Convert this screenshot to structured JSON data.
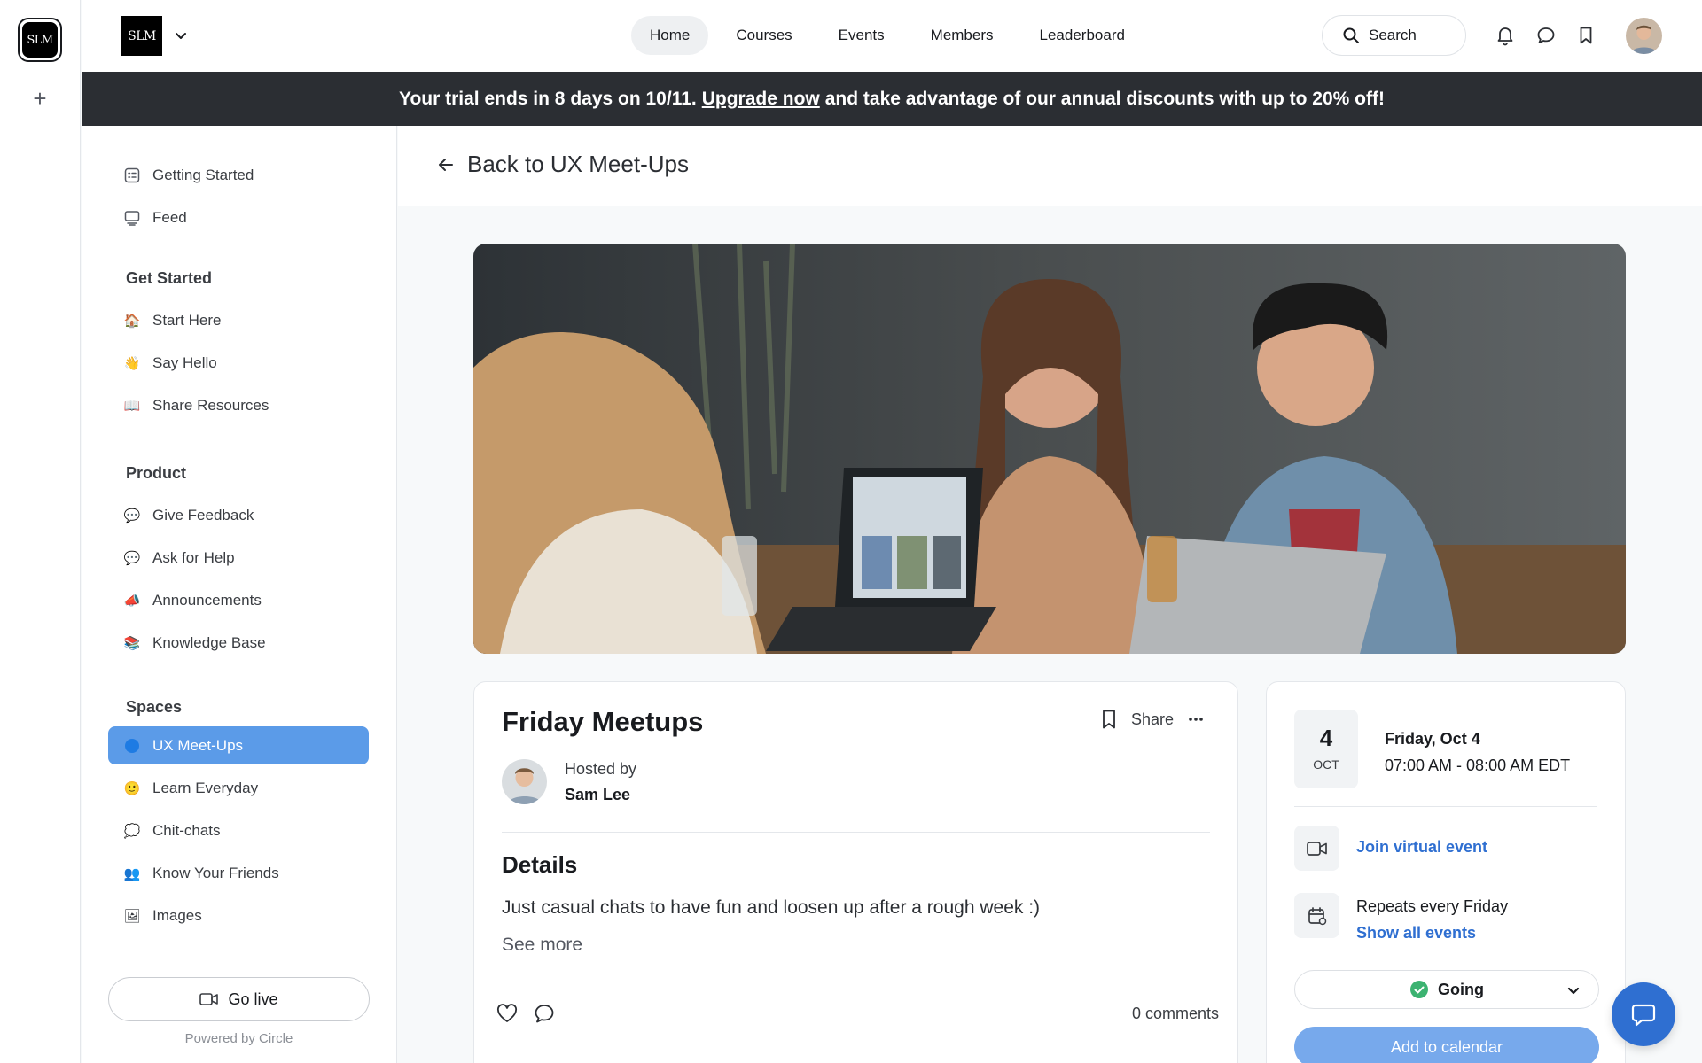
{
  "rail": {
    "logo_text": "SLM"
  },
  "header": {
    "brand_text": "SLM",
    "nav": [
      "Home",
      "Courses",
      "Events",
      "Members",
      "Leaderboard"
    ],
    "search_label": "Search"
  },
  "banner": {
    "prefix": "Your trial ends in 8 days on 10/11.",
    "link": "Upgrade now",
    "suffix": "and take advantage of our annual discounts with up to 20% off!"
  },
  "sidebar": {
    "top_items": [
      {
        "label": "Getting Started",
        "icon": "checklist-icon"
      },
      {
        "label": "Feed",
        "icon": "feed-icon"
      }
    ],
    "sections": [
      {
        "title": "Get Started",
        "items": [
          {
            "label": "Start Here",
            "emoji": "🏠"
          },
          {
            "label": "Say Hello",
            "emoji": "👋"
          },
          {
            "label": "Share Resources",
            "emoji": "📖"
          }
        ]
      },
      {
        "title": "Product",
        "items": [
          {
            "label": "Give Feedback",
            "emoji": "💬"
          },
          {
            "label": "Ask for Help",
            "emoji": "💬"
          },
          {
            "label": "Announcements",
            "emoji": "📣"
          },
          {
            "label": "Knowledge Base",
            "emoji": "📚"
          }
        ]
      },
      {
        "title": "Spaces",
        "items": [
          {
            "label": "UX Meet-Ups",
            "emoji": "🔵",
            "active": true
          },
          {
            "label": "Learn Everyday",
            "emoji": "🙂"
          },
          {
            "label": "Chit-chats",
            "emoji": "💭"
          },
          {
            "label": "Know Your Friends",
            "emoji": "👥"
          },
          {
            "label": "Images",
            "emoji": "🖼"
          }
        ]
      }
    ],
    "go_live": "Go live",
    "powered_by": "Powered by Circle"
  },
  "main": {
    "back_label": "Back to UX Meet-Ups",
    "event": {
      "title": "Friday Meetups",
      "share_label": "Share",
      "hosted_by_label": "Hosted by",
      "host_name": "Sam Lee",
      "details_heading": "Details",
      "details_text": "Just casual chats to have fun and loosen up after a rough week :)",
      "see_more": "See more",
      "comments": "0 comments"
    },
    "schedule": {
      "day": "4",
      "month": "OCT",
      "date_line": "Friday, Oct 4",
      "time_line": "07:00 AM - 08:00 AM EDT",
      "join_label": "Join virtual event",
      "repeats_label": "Repeats every Friday",
      "show_all": "Show all events",
      "rsvp": "Going",
      "add_calendar": "Add to calendar"
    }
  },
  "colors": {
    "accent": "#2f6fd1",
    "active_space": "#5b9be8",
    "banner_bg": "#2b2e33",
    "going_check": "#3cb371"
  }
}
